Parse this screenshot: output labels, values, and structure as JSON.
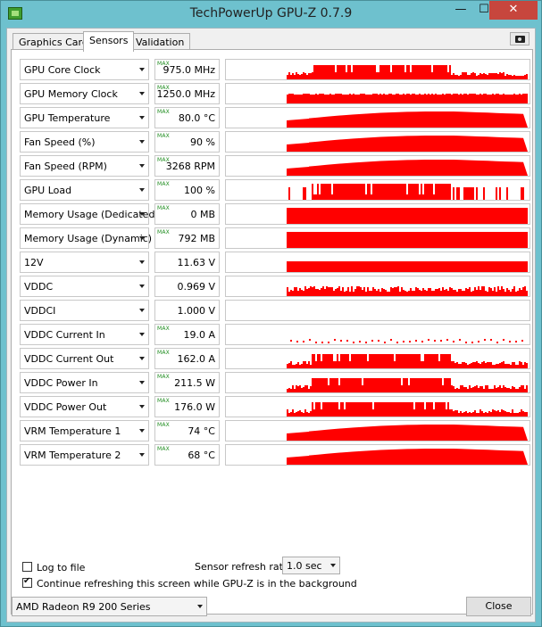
{
  "window": {
    "title": "TechPowerUp GPU-Z 0.7.9",
    "min_glyph": "—",
    "max_glyph": "☐",
    "close_glyph": "✕"
  },
  "tabs": [
    {
      "label": "Graphics Card",
      "active": false
    },
    {
      "label": "Sensors",
      "active": true
    },
    {
      "label": "Validation",
      "active": false
    }
  ],
  "max_badge": "MAX",
  "graph_color": "#ff0000",
  "sensors": [
    {
      "label": "GPU Core Clock",
      "value": "975.0 MHz",
      "max": true,
      "pattern": "spiky"
    },
    {
      "label": "GPU Memory Clock",
      "value": "1250.0 MHz",
      "max": true,
      "pattern": "dense"
    },
    {
      "label": "GPU Temperature",
      "value": "80.0 °C",
      "max": true,
      "pattern": "curve"
    },
    {
      "label": "Fan Speed (%)",
      "value": "90 %",
      "max": true,
      "pattern": "curve"
    },
    {
      "label": "Fan Speed (RPM)",
      "value": "3268 RPM",
      "max": true,
      "pattern": "curve"
    },
    {
      "label": "GPU Load",
      "value": "100 %",
      "max": true,
      "pattern": "load"
    },
    {
      "label": "Memory Usage (Dedicated)",
      "value": "0 MB",
      "max": true,
      "pattern": "full"
    },
    {
      "label": "Memory Usage (Dynamic)",
      "value": "792 MB",
      "max": true,
      "pattern": "full"
    },
    {
      "label": "12V",
      "value": "11.63 V",
      "max": false,
      "pattern": "flat"
    },
    {
      "label": "VDDC",
      "value": "0.969 V",
      "max": false,
      "pattern": "noisy"
    },
    {
      "label": "VDDCI",
      "value": "1.000 V",
      "max": false,
      "pattern": "none"
    },
    {
      "label": "VDDC Current In",
      "value": "19.0 A",
      "max": true,
      "pattern": "dots"
    },
    {
      "label": "VDDC Current Out",
      "value": "162.0 A",
      "max": true,
      "pattern": "spiky"
    },
    {
      "label": "VDDC Power In",
      "value": "211.5 W",
      "max": true,
      "pattern": "spiky"
    },
    {
      "label": "VDDC Power Out",
      "value": "176.0 W",
      "max": true,
      "pattern": "spiky"
    },
    {
      "label": "VRM Temperature 1",
      "value": "74 °C",
      "max": true,
      "pattern": "curve"
    },
    {
      "label": "VRM Temperature 2",
      "value": "68 °C",
      "max": true,
      "pattern": "curve"
    }
  ],
  "bottom": {
    "log_to_file_label": "Log to file",
    "log_to_file_checked": false,
    "refresh_rate_label": "Sensor refresh rate:",
    "refresh_rate_value": "1.0 sec",
    "continue_label": "Continue refreshing this screen while GPU-Z is in the background",
    "continue_checked": true
  },
  "footer": {
    "gpu_select_value": "AMD Radeon R9 200 Series",
    "close_label": "Close"
  }
}
